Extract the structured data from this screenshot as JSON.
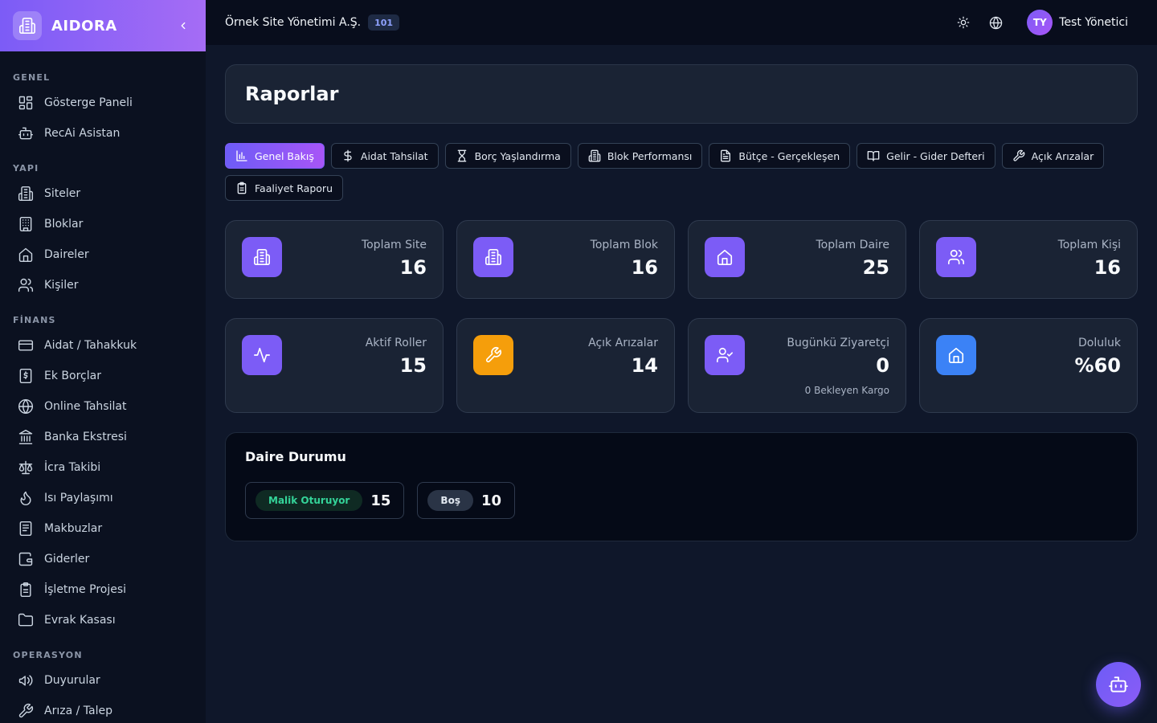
{
  "brand": {
    "name": "AIDORA",
    "icon": "building-icon"
  },
  "sidebar": {
    "sections": [
      {
        "title": "GENEL",
        "items": [
          {
            "label": "Gösterge Paneli",
            "icon": "dashboard-icon"
          },
          {
            "label": "RecAi Asistan",
            "icon": "bot-icon"
          }
        ]
      },
      {
        "title": "YAPI",
        "items": [
          {
            "label": "Siteler",
            "icon": "building-icon"
          },
          {
            "label": "Bloklar",
            "icon": "office-icon"
          },
          {
            "label": "Daireler",
            "icon": "home-icon"
          },
          {
            "label": "Kişiler",
            "icon": "users-icon"
          }
        ]
      },
      {
        "title": "FİNANS",
        "items": [
          {
            "label": "Aidat / Tahakkuk",
            "icon": "credit-card-icon"
          },
          {
            "label": "Ek Borçlar",
            "icon": "dollar-doc-icon"
          },
          {
            "label": "Online Tahsilat",
            "icon": "globe-icon"
          },
          {
            "label": "Banka Ekstresi",
            "icon": "bank-icon"
          },
          {
            "label": "İcra Takibi",
            "icon": "scale-icon"
          },
          {
            "label": "Isı Paylaşımı",
            "icon": "flame-icon"
          },
          {
            "label": "Makbuzlar",
            "icon": "receipt-icon"
          },
          {
            "label": "Giderler",
            "icon": "wallet-icon"
          },
          {
            "label": "İşletme Projesi",
            "icon": "clipboard-icon"
          },
          {
            "label": "Evrak Kasası",
            "icon": "folder-icon"
          }
        ]
      },
      {
        "title": "OPERASYON",
        "items": [
          {
            "label": "Duyurular",
            "icon": "megaphone-icon"
          },
          {
            "label": "Arıza / Talep",
            "icon": "wrench-icon"
          }
        ]
      }
    ]
  },
  "header": {
    "org_name": "Örnek Site Yönetimi A.Ş.",
    "org_badge": "101",
    "user_initials": "TY",
    "user_name": "Test Yönetici"
  },
  "page": {
    "title": "Raporlar"
  },
  "tabs": [
    {
      "label": "Genel Bakış",
      "icon": "bar-chart-icon",
      "active": true
    },
    {
      "label": "Aidat Tahsilat",
      "icon": "dollar-icon"
    },
    {
      "label": "Borç Yaşlandırma",
      "icon": "hourglass-icon"
    },
    {
      "label": "Blok Performansı",
      "icon": "building-icon"
    },
    {
      "label": "Bütçe - Gerçekleşen",
      "icon": "document-icon"
    },
    {
      "label": "Gelir - Gider Defteri",
      "icon": "book-icon"
    },
    {
      "label": "Açık Arızalar",
      "icon": "wrench-icon"
    },
    {
      "label": "Faaliyet Raporu",
      "icon": "clipboard-icon"
    }
  ],
  "stats": [
    {
      "label": "Toplam Site",
      "value": "16",
      "icon": "building-icon",
      "color": "#7c5cf6"
    },
    {
      "label": "Toplam Blok",
      "value": "16",
      "icon": "building-icon",
      "color": "#7c5cf6"
    },
    {
      "label": "Toplam Daire",
      "value": "25",
      "icon": "home-icon",
      "color": "#7c5cf6"
    },
    {
      "label": "Toplam Kişi",
      "value": "16",
      "icon": "users-icon",
      "color": "#7c5cf6"
    },
    {
      "label": "Aktif Roller",
      "value": "15",
      "icon": "activity-icon",
      "color": "#7c5cf6"
    },
    {
      "label": "Açık Arızalar",
      "value": "14",
      "icon": "wrench-icon",
      "color": "#f59e0b"
    },
    {
      "label": "Bugünkü Ziyaretçi",
      "value": "0",
      "sub": "0 Bekleyen Kargo",
      "icon": "user-check-icon",
      "color": "#7c5cf6"
    },
    {
      "label": "Doluluk",
      "value": "%60",
      "icon": "home-icon",
      "color": "#3b82f6"
    }
  ],
  "apartment_status": {
    "title": "Daire Durumu",
    "items": [
      {
        "label": "Malik Oturuyor",
        "value": "15",
        "color": "#34d399"
      },
      {
        "label": "Boş",
        "value": "10",
        "color": "#e2e8f0"
      }
    ]
  }
}
